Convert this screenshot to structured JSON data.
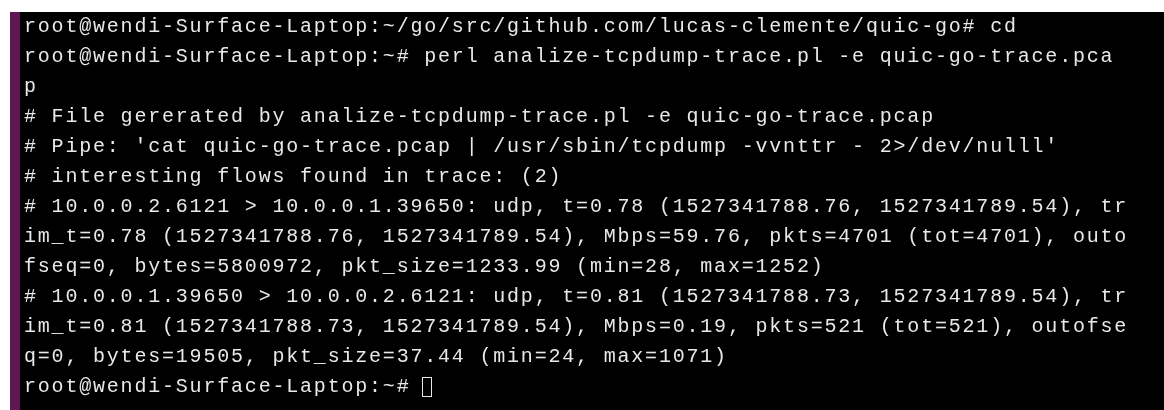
{
  "terminal": {
    "lines": [
      "root@wendi-Surface-Laptop:~/go/src/github.com/lucas-clemente/quic-go# cd",
      "root@wendi-Surface-Laptop:~# perl analize-tcpdump-trace.pl -e quic-go-trace.pca",
      "p",
      "# File gererated by analize-tcpdump-trace.pl -e quic-go-trace.pcap",
      "# Pipe: 'cat quic-go-trace.pcap | /usr/sbin/tcpdump -vvnttr - 2>/dev/nulll'",
      "# interesting flows found in trace: (2)",
      "# 10.0.0.2.6121 > 10.0.0.1.39650: udp, t=0.78 (1527341788.76, 1527341789.54), tr",
      "im_t=0.78 (1527341788.76, 1527341789.54), Mbps=59.76, pkts=4701 (tot=4701), outo",
      "fseq=0, bytes=5800972, pkt_size=1233.99 (min=28, max=1252)",
      "# 10.0.0.1.39650 > 10.0.0.2.6121: udp, t=0.81 (1527341788.73, 1527341789.54), tr",
      "im_t=0.81 (1527341788.73, 1527341789.54), Mbps=0.19, pkts=521 (tot=521), outofse",
      "q=0, bytes=19505, pkt_size=37.44 (min=24, max=1071)"
    ],
    "prompt": "root@wendi-Surface-Laptop:~#"
  }
}
